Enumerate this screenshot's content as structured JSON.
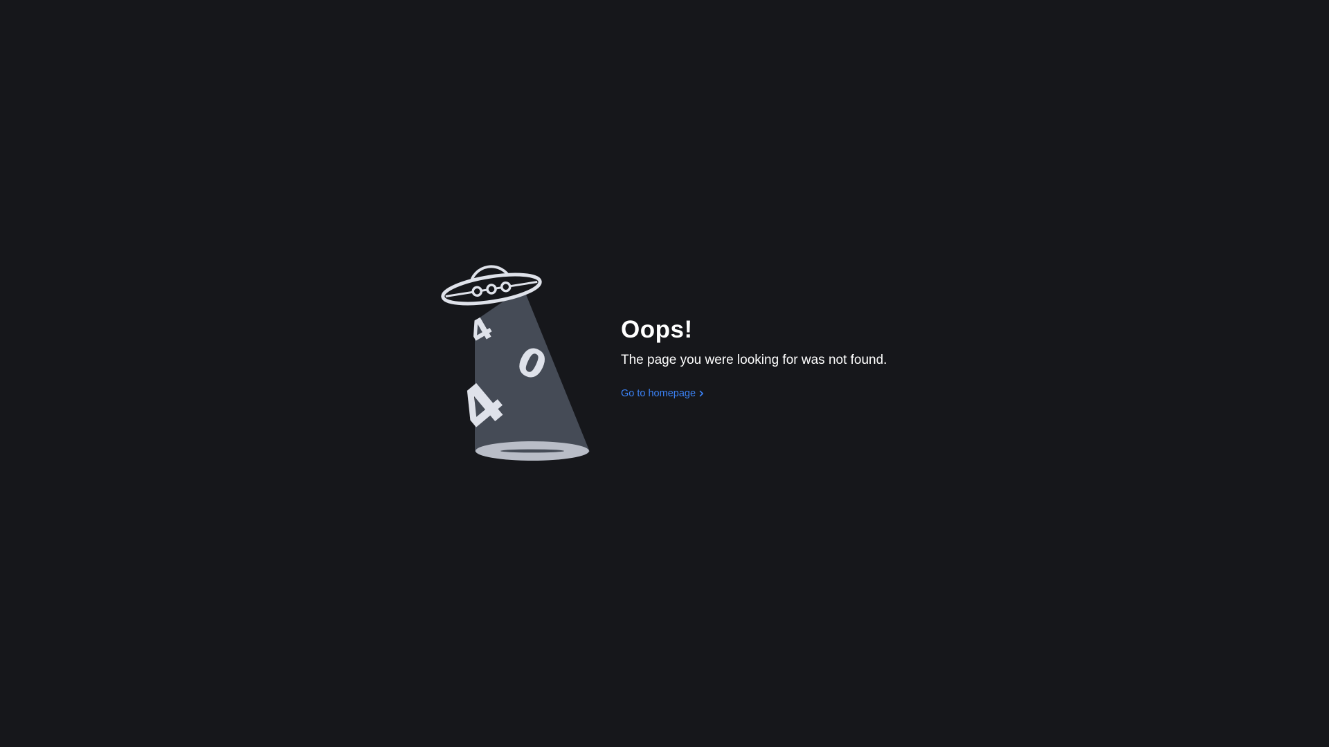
{
  "error_page": {
    "title": "Oops!",
    "message": "The page you were looking for was not found.",
    "homepage_link": {
      "label": "Go to homepage",
      "icon": "chevron-right-icon"
    },
    "illustration": {
      "icon": "ufo-icon",
      "digits": [
        "4",
        "0",
        "4"
      ]
    }
  },
  "colors": {
    "background": "#16171b",
    "text": "#ffffff",
    "link": "#3b82f6",
    "beam": "#454b56",
    "ufo": "#dfe2ea",
    "ground": "#b9bdc7"
  }
}
